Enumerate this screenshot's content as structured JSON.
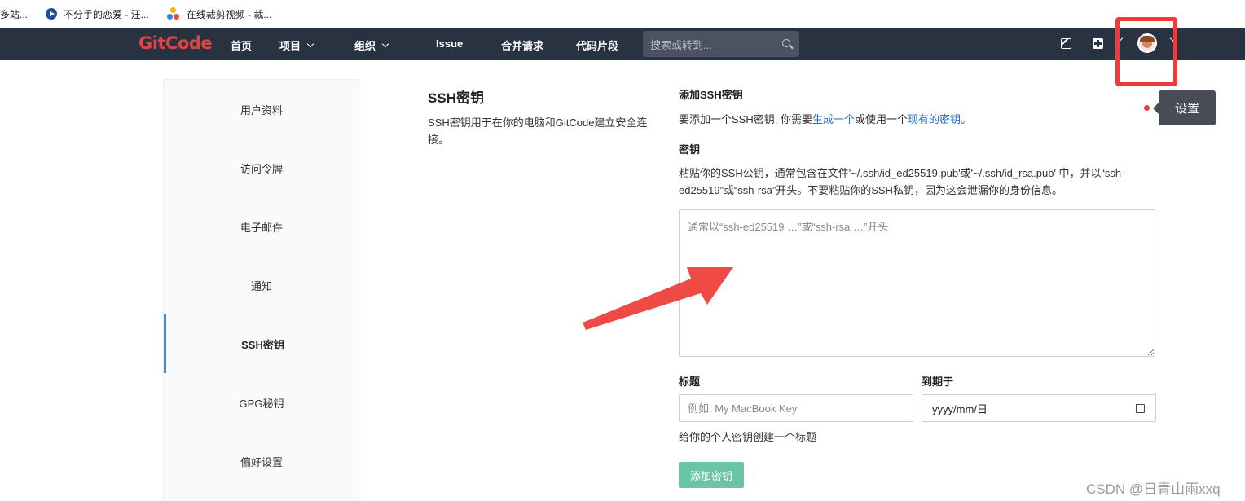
{
  "bookmarks": [
    {
      "label": "多站..."
    },
    {
      "label": "不分手的恋爱 - 汪..."
    },
    {
      "label": "在线裁剪视频 - 裁..."
    }
  ],
  "navbar": {
    "logo": "GitCode",
    "items": [
      "首页",
      "项目",
      "组织",
      "Issue",
      "合并请求",
      "代码片段"
    ],
    "search_placeholder": "搜索或转到..."
  },
  "tooltip": "设置",
  "sidebar": {
    "items": [
      "用户资料",
      "访问令牌",
      "电子邮件",
      "通知",
      "SSH密钥",
      "GPG秘钥",
      "偏好设置"
    ],
    "active": "SSH密钥"
  },
  "section": {
    "title": "SSH密钥",
    "description": "SSH密钥用于在你的电脑和GitCode建立安全连接。"
  },
  "form": {
    "title": "添加SSH密钥",
    "intro_prefix": "要添加一个SSH密钥, 你需要",
    "intro_link1": "生成一个",
    "intro_middle": "或使用一个",
    "intro_link2": "现有的密钥",
    "intro_suffix": "。",
    "key_label": "密钥",
    "key_help": "粘贴你的SSH公钥，通常包含在文件'~/.ssh/id_ed25519.pub'或'~/.ssh/id_rsa.pub' 中，并以“ssh-ed25519”或“ssh-rsa”开头。不要粘贴你的SSH私钥，因为这会泄漏你的身份信息。",
    "key_placeholder": "通常以“ssh-ed25519 …”或“ssh-rsa …”开头",
    "title_label": "标题",
    "title_placeholder": "例如: My MacBook Key",
    "expires_label": "到期于",
    "expires_value": "yyyy/mm/日",
    "title_help": "给你的个人密钥创建一个标题",
    "submit_label": "添加密钥"
  },
  "watermark": "CSDN @日青山雨xxq",
  "colors": {
    "navbar_bg": "#293241",
    "logo": "#e0443f",
    "active_indicator": "#3e8ee0",
    "link": "#1f6fd1",
    "submit_bg": "#6ac4a6",
    "annotation_red": "#ef3b3b"
  }
}
